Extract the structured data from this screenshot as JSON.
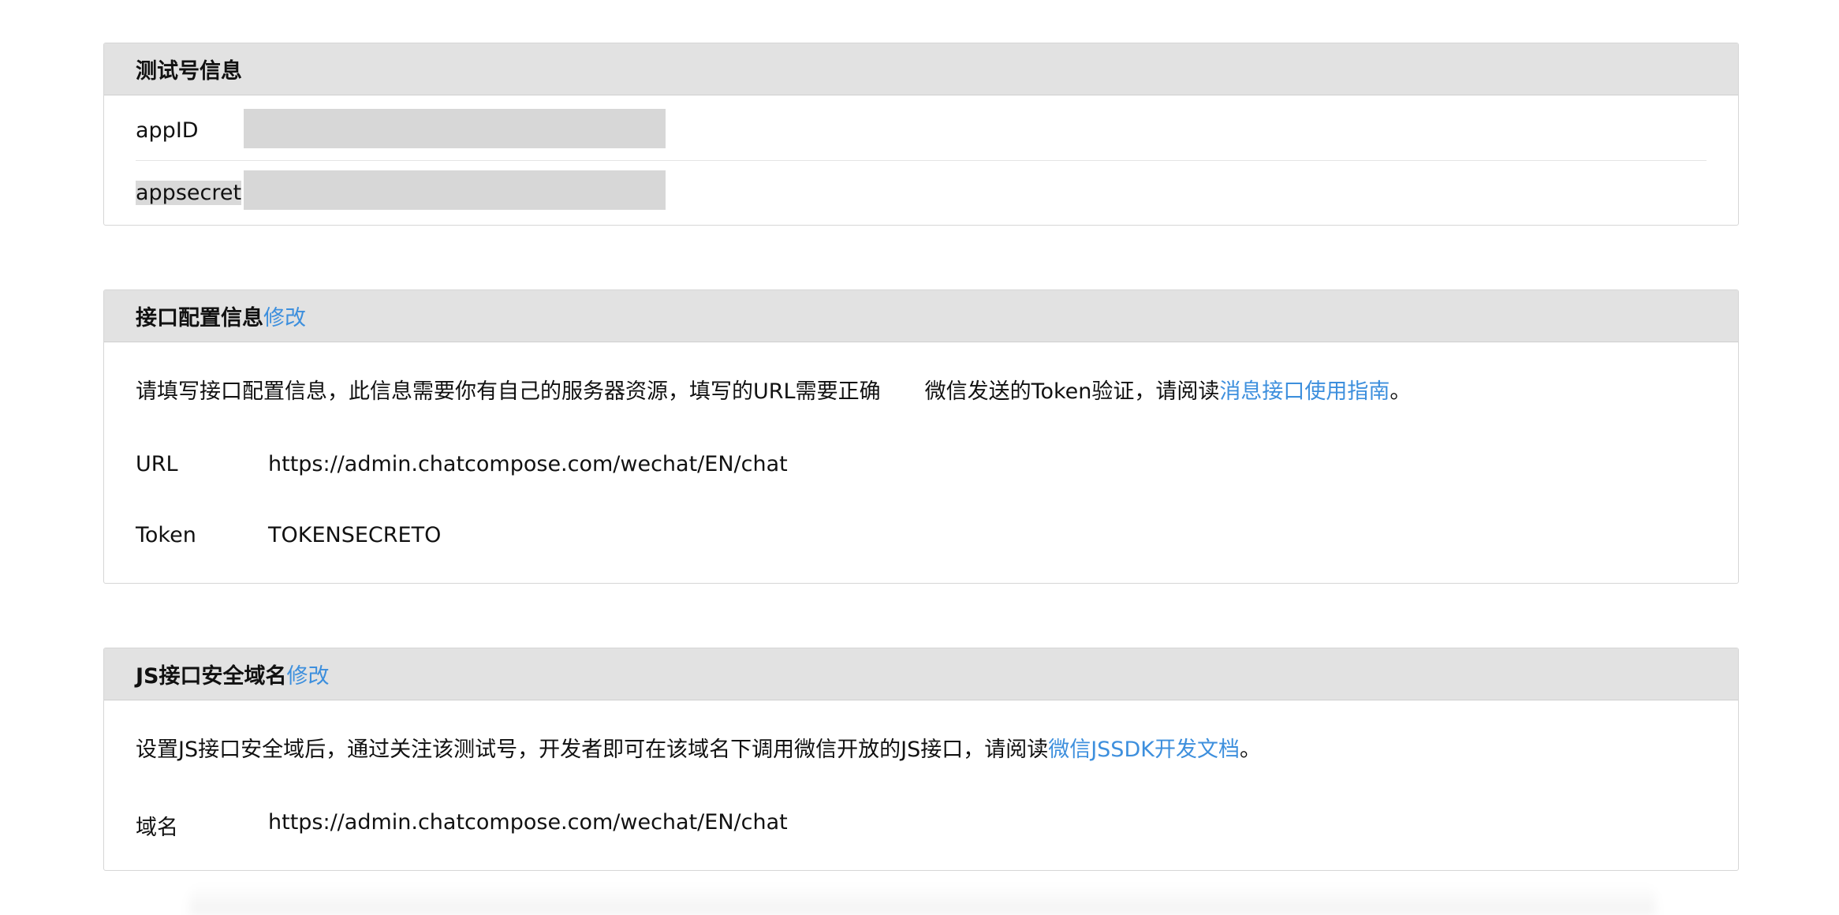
{
  "test_account": {
    "title": "测试号信息",
    "appid_label": "appID",
    "appsecret_label": "appsecret"
  },
  "interface_config": {
    "title": "接口配置信息",
    "edit_label": "修改",
    "description_before_gap": "请填写接口配置信息，此信息需要你有自己的服务器资源，填写的URL需要正确",
    "description_after_gap": "微信发送的Token验证，请阅读",
    "guide_link": "消息接口使用指南",
    "description_end": "。",
    "url_label": "URL",
    "url_value": "https://admin.chatcompose.com/wechat/EN/chat",
    "token_label": "Token",
    "token_value": "TOKENSECRETO"
  },
  "js_domain": {
    "title": "JS接口安全域名",
    "edit_label": "修改",
    "description": "设置JS接口安全域后，通过关注该测试号，开发者即可在该域名下调用微信开放的JS接口，请阅读",
    "doc_link": "微信JSSDK开发文档",
    "description_end": "。",
    "domain_label": "域名",
    "domain_value": "https://admin.chatcompose.com/wechat/EN/chat"
  }
}
